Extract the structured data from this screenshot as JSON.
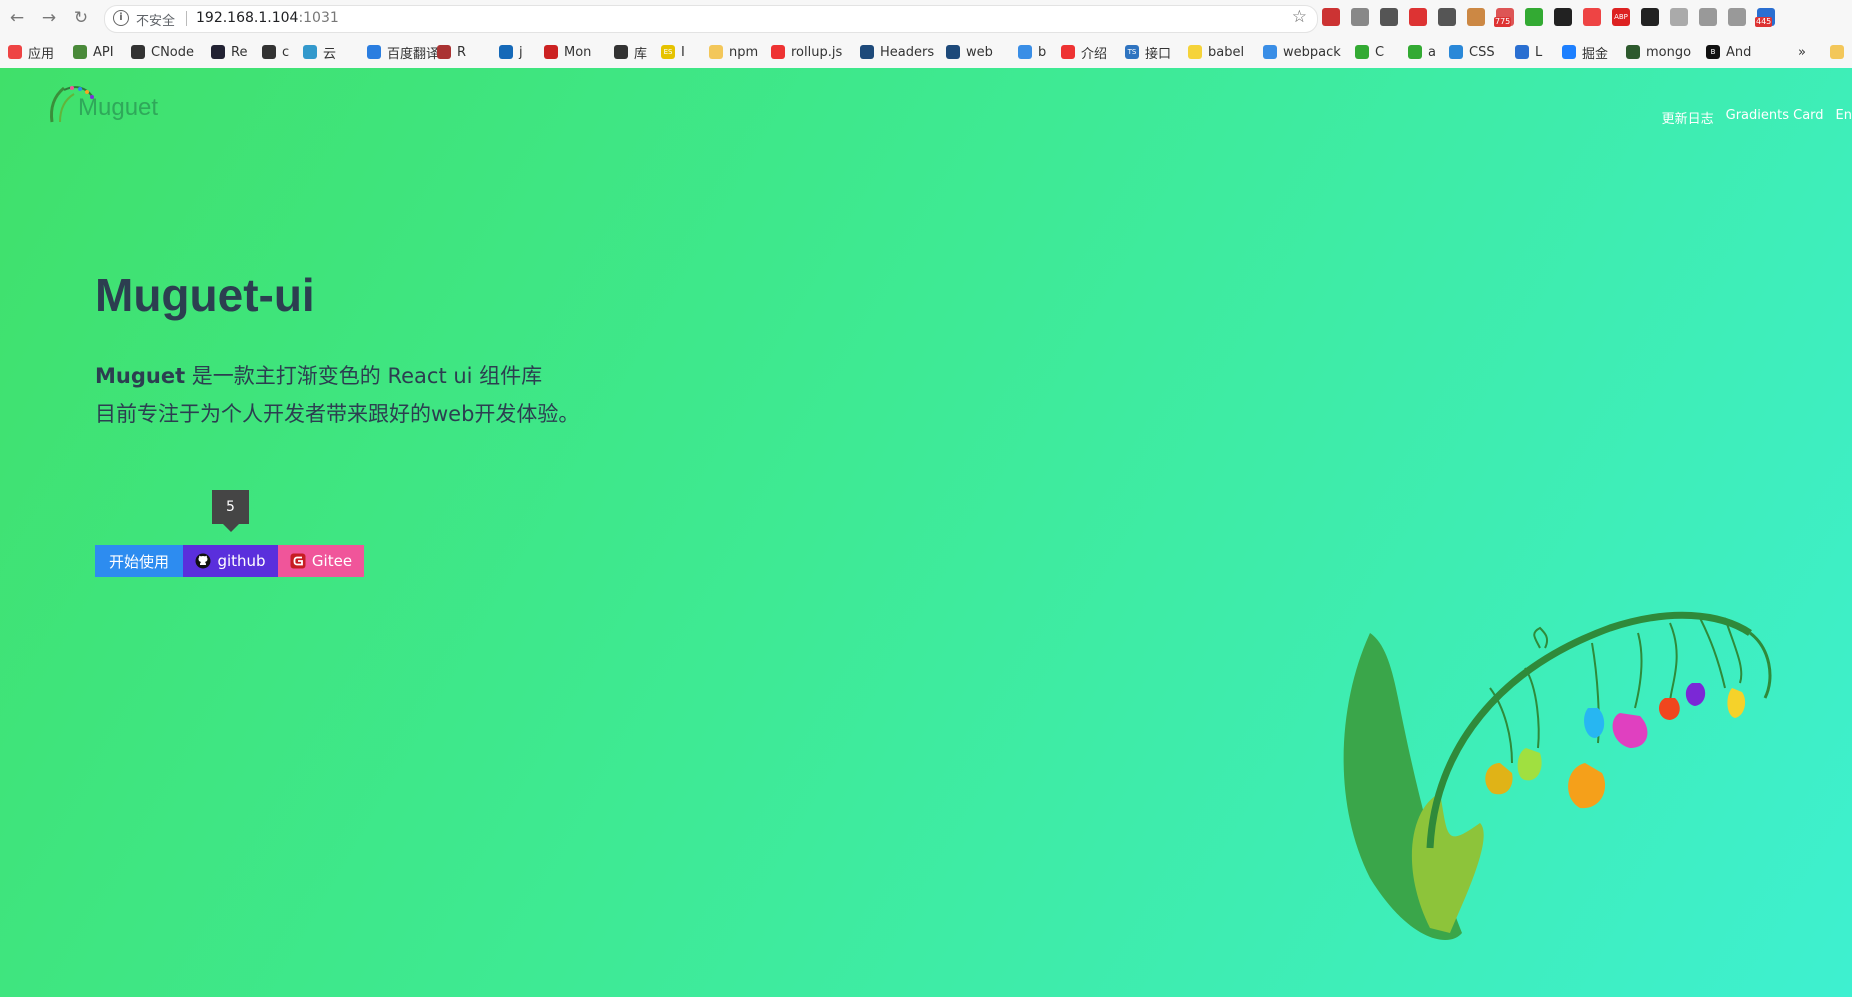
{
  "browser": {
    "insecure_label": "不安全",
    "url_host": "192.168.1.104",
    "url_port": ":1031",
    "nav_icons": [
      "back-arrow-icon",
      "forward-arrow-icon",
      "reload-icon"
    ],
    "extensions": [
      {
        "icon": "translate-icon",
        "color": "#c33"
      },
      {
        "icon": "cloud-icon",
        "color": "#888"
      },
      {
        "icon": "vue-icon",
        "color": "#555"
      },
      {
        "icon": "puzzle-icon",
        "color": "#d33"
      },
      {
        "icon": "lens-icon",
        "color": "#555"
      },
      {
        "icon": "owl-icon",
        "color": "#c84"
      },
      {
        "icon": "mail-icon",
        "color": "#d55",
        "badge": "775"
      },
      {
        "icon": "refresh-leaf-icon",
        "color": "#3a3"
      },
      {
        "icon": "box-icon",
        "color": "#222"
      },
      {
        "icon": "colorful-star-icon",
        "color": "#e44"
      },
      {
        "icon": "abp-icon",
        "color": "#d22",
        "text": "ABP"
      },
      {
        "icon": "github-icon",
        "color": "#222"
      },
      {
        "icon": "moon-icon",
        "color": "#aaa"
      },
      {
        "icon": "shield-icon",
        "color": "#999"
      },
      {
        "icon": "cat-icon",
        "color": "#999"
      },
      {
        "icon": "calendar-icon",
        "color": "#2a6fd1",
        "badge": "445"
      }
    ]
  },
  "bookmarks": [
    {
      "label": "应用",
      "icon": "apps-icon",
      "color": "#e44"
    },
    {
      "label": "API",
      "icon": "hex-icon",
      "color": "#4a8a3a"
    },
    {
      "label": "CNode",
      "icon": "c-icon",
      "color": "#333"
    },
    {
      "label": "Re",
      "icon": "re-icon",
      "color": "#223"
    },
    {
      "label": "c",
      "icon": "cup-icon",
      "color": "#333"
    },
    {
      "label": "云",
      "icon": "cloud-icon",
      "color": "#39c"
    },
    {
      "label": "百度翻译",
      "icon": "translate-icon",
      "color": "#2b7ee0"
    },
    {
      "label": "R",
      "icon": "dots-icon",
      "color": "#a33"
    },
    {
      "label": "j",
      "icon": "swirl-icon",
      "color": "#1569b8"
    },
    {
      "label": "Mon",
      "icon": "m-icon",
      "color": "#c22"
    },
    {
      "label": "库",
      "icon": "quill-icon",
      "color": "#333"
    },
    {
      "label": "I",
      "icon": "es-icon",
      "color": "#e6c300",
      "text": "ES"
    },
    {
      "label": "npm",
      "icon": "folder-icon",
      "color": "#f3c75a"
    },
    {
      "label": "rollup.js",
      "icon": "rollup-icon",
      "color": "#e33"
    },
    {
      "label": "Headers",
      "icon": "bird-icon",
      "color": "#1e4a7a"
    },
    {
      "label": "web",
      "icon": "bird-icon",
      "color": "#1e4a7a"
    },
    {
      "label": "b",
      "icon": "atom-icon",
      "color": "#3a8ee6"
    },
    {
      "label": "介绍",
      "icon": "circle-icon",
      "color": "#e33"
    },
    {
      "label": "接口",
      "icon": "ts-icon",
      "color": "#2f74c0",
      "text": "TS"
    },
    {
      "label": "babel",
      "icon": "babel-icon",
      "color": "#f5d33a"
    },
    {
      "label": "webpack",
      "icon": "webpack-icon",
      "color": "#3a8ee6"
    },
    {
      "label": "C",
      "icon": "wechat-icon",
      "color": "#3a3"
    },
    {
      "label": "a",
      "icon": "a-icon",
      "color": "#3a3"
    },
    {
      "label": "CSS",
      "icon": "plus-icon",
      "color": "#2a88d8"
    },
    {
      "label": "L",
      "icon": "dash-icon",
      "color": "#2a6fd1"
    },
    {
      "label": "掘金",
      "icon": "juejin-icon",
      "color": "#1e80ff"
    },
    {
      "label": "mongo",
      "icon": "leaf-icon",
      "color": "#2e5a2e"
    },
    {
      "label": "And",
      "icon": "b-icon",
      "color": "#111",
      "text": "B"
    }
  ],
  "bookmarks_overflow": "»",
  "site": {
    "logo_text": "Muguet",
    "nav": [
      "更新日志",
      "Gradients Card",
      "En"
    ],
    "title": "Muguet-ui",
    "intro_bold": "Muguet",
    "intro_rest": " 是一款主打渐变色的 React ui 组件库",
    "intro_line2": "目前专注于为个人开发者带来跟好的web开发体验。",
    "tooltip": "5",
    "buttons": {
      "start": "开始使用",
      "github": "github",
      "gitee": "Gitee"
    },
    "colors": {
      "start": "#2d8cf0",
      "github": "#5a2fdc",
      "gitee": "#f0559a",
      "text": "#2c3e50"
    }
  }
}
